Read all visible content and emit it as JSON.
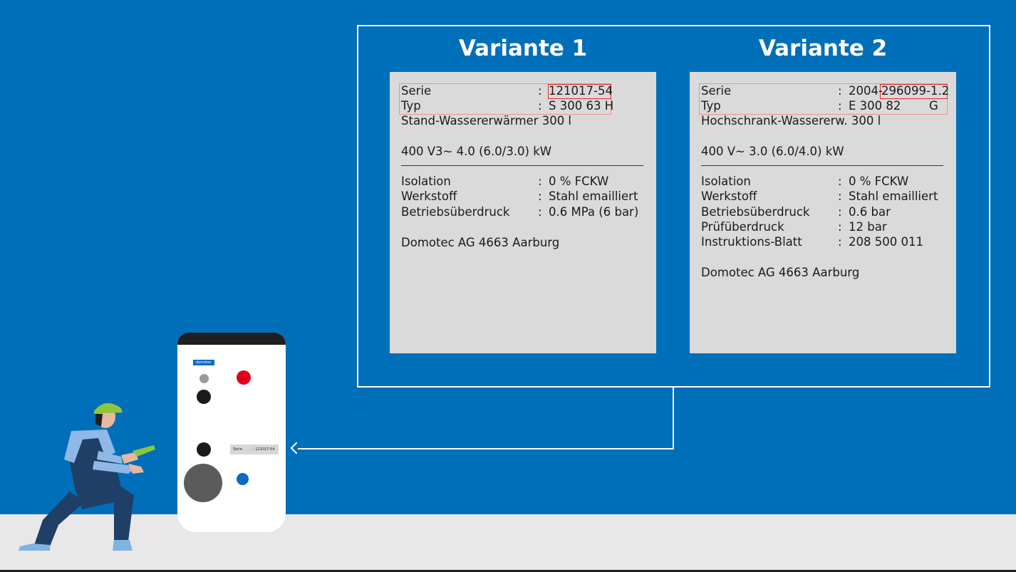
{
  "variants": [
    {
      "title": "Variante 1",
      "serie_label": "Serie",
      "serie_value": "121017-54",
      "typ_label": "Typ",
      "typ_value": "S 300 63 H",
      "description": "Stand-Wassererwärmer 300 l",
      "power": "400 V3~ 4.0 (6.0/3.0) kW",
      "specs": [
        {
          "label": "Isolation",
          "value": "0 % FCKW"
        },
        {
          "label": "Werkstoff",
          "value": "Stahl emailliert"
        },
        {
          "label": "Betriebsüberdruck",
          "value": "0.6 MPa (6 bar)"
        }
      ],
      "manufacturer": "Domotec AG 4663 Aarburg"
    },
    {
      "title": "Variante 2",
      "serie_label": "Serie",
      "serie_prefix": "2004-",
      "serie_value": "296099-1.2",
      "typ_label": "Typ",
      "typ_value": "E 300 82",
      "typ_suffix": "G",
      "description": "Hochschrank-Wassererw. 300 l",
      "power": "400 V~ 3.0 (6.0/4.0) kW",
      "specs": [
        {
          "label": "Isolation",
          "value": "0 % FCKW"
        },
        {
          "label": "Werkstoff",
          "value": "Stahl emailliert"
        },
        {
          "label": "Betriebsüberdruck",
          "value": "0.6 bar"
        },
        {
          "label": "Prüfüberdruck",
          "value": "12 bar"
        },
        {
          "label": "Instruktions-Blatt",
          "value": "208 500 011"
        }
      ],
      "manufacturer": "Domotec AG 4663 Aarburg"
    }
  ],
  "colon": ":",
  "heater": {
    "brand": "domotec",
    "sticker_label": "Serie",
    "sticker_value": ": 121017-54"
  },
  "colors": {
    "background": "#006fba",
    "plate": "#dadada",
    "highlight": "#e2282c",
    "floor": "#e8e8e8"
  }
}
